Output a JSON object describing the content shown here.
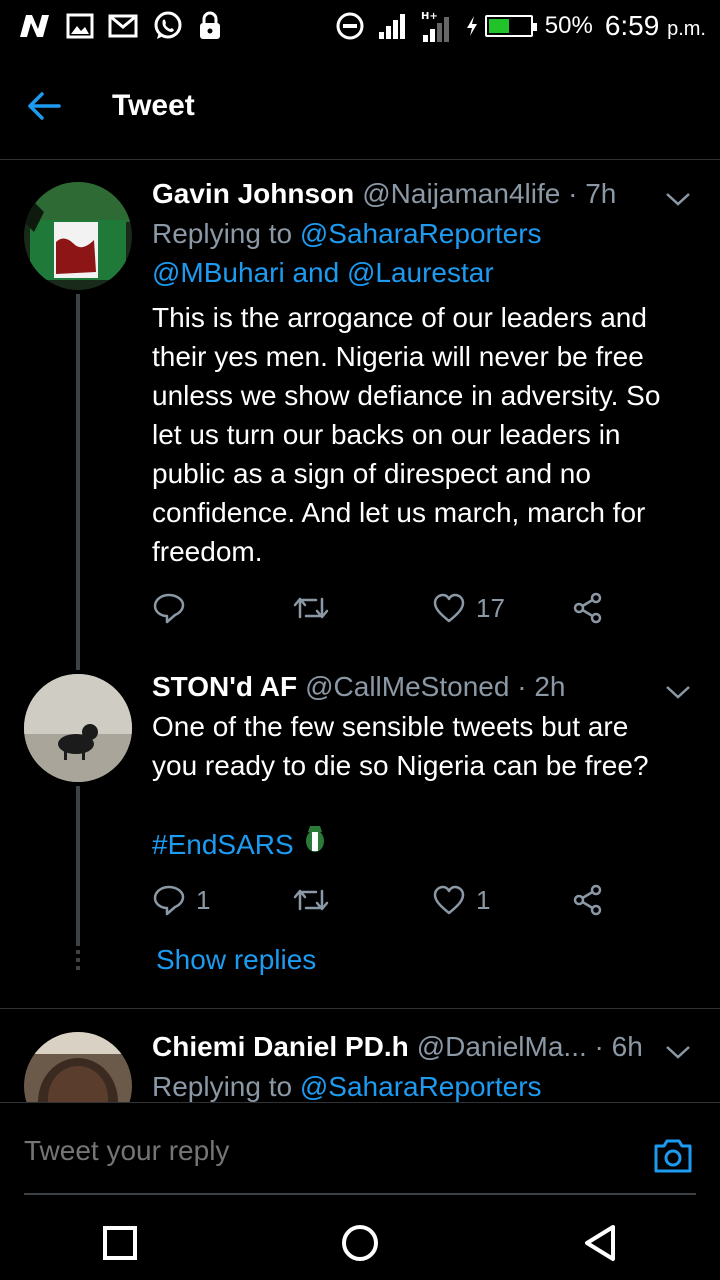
{
  "status_bar": {
    "left_icons": [
      "network-n-icon",
      "gallery-icon",
      "gmail-icon",
      "whatsapp-icon",
      "lock-icon"
    ],
    "right_icons": [
      "do-not-disturb-icon",
      "signal-icon",
      "signal-hplus-icon",
      "charging-icon",
      "battery-icon"
    ],
    "battery": "50%",
    "time": "6:59",
    "ampm": "p.m."
  },
  "header": {
    "title": "Tweet"
  },
  "tweets": [
    {
      "name": "Gavin Johnson",
      "handle": "@Naijaman4life",
      "time": "7h",
      "replying_label": "Replying to",
      "replying_to": [
        "@SaharaReporters",
        "@MBuhari",
        "@Laurestar"
      ],
      "and_word": "and",
      "text": "This is the arrogance of our leaders and their yes men. Nigeria will never be free unless we show defiance in adversity. So let us turn our backs on our leaders in public as a sign of direspect and no confidence. And let us march, march for freedom.",
      "replies": "",
      "retweets": "",
      "likes": "17"
    },
    {
      "name": "STON'd AF",
      "handle": "@CallMeStoned",
      "time": "2h",
      "text": "One of the few sensible tweets but are you ready to die so Nigeria can be free?",
      "hashtag": "#EndSARS",
      "replies": "1",
      "retweets": "",
      "likes": "1",
      "show_replies": "Show replies"
    },
    {
      "name": "Chiemi Daniel PD.h",
      "handle": "@DanielMa...",
      "time": "6h",
      "replying_label": "Replying to",
      "replying_to": [
        "@SaharaReporters"
      ]
    }
  ],
  "reply_bar": {
    "placeholder": "Tweet your reply"
  },
  "colors": {
    "accent": "#1d9bf0",
    "muted": "#8b98a5",
    "background": "#000000",
    "battery_fill": "#21c22a"
  }
}
